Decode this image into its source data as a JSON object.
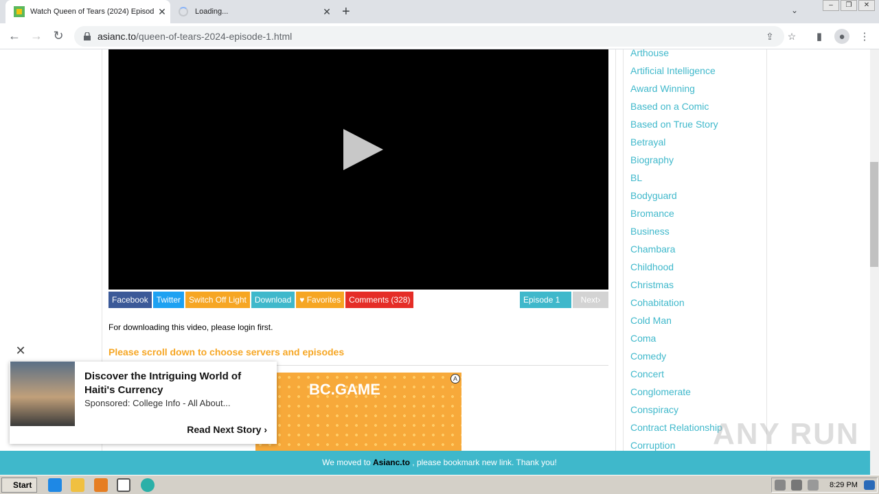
{
  "browser": {
    "tabs": [
      {
        "title": "Watch Queen of Tears (2024) Episod",
        "state": "active"
      },
      {
        "title": "Loading...",
        "state": "loading"
      }
    ],
    "url_domain": "asianc.to",
    "url_path": "/queen-of-tears-2024-episode-1.html"
  },
  "player": {
    "buttons": [
      "Facebook",
      "Twitter",
      "Switch Off Light",
      "Download",
      "Favorites",
      "Comments (328)"
    ],
    "episode_label": "Episode 1",
    "next_label": "Next"
  },
  "content": {
    "download_note": "For downloading this video, please login first.",
    "scroll_note": "Please scroll down to choose servers and episodes",
    "ad_logo": "BC.GAME"
  },
  "sidebar": {
    "genres": [
      "Arthouse",
      "Artificial Intelligence",
      "Award Winning",
      "Based on a Comic",
      "Based on True Story",
      "Betrayal",
      "Biography",
      "BL",
      "Bodyguard",
      "Bromance",
      "Business",
      "Chambara",
      "Childhood",
      "Christmas",
      "Cohabitation",
      "Cold Man",
      "Coma",
      "Comedy",
      "Concert",
      "Conglomerate",
      "Conspiracy",
      "Contract Relationship",
      "Corruption"
    ]
  },
  "popup": {
    "headline": "Discover the Intriguing World of Haiti's Currency",
    "sponsored": "Sponsored:  College Info - All About...",
    "cta": "Read Next Story"
  },
  "banner": {
    "prefix": "We moved to ",
    "domain": "Asianc.to",
    "suffix": " , please bookmark new link. Thank you!"
  },
  "watermark": "ANY RUN",
  "taskbar": {
    "start": "Start",
    "time": "8:29 PM"
  },
  "colors": {
    "accent": "#3fb8cb",
    "orange": "#f6a623",
    "facebook": "#3b5998",
    "twitter": "#1da1f2",
    "comments": "#e52d27"
  }
}
